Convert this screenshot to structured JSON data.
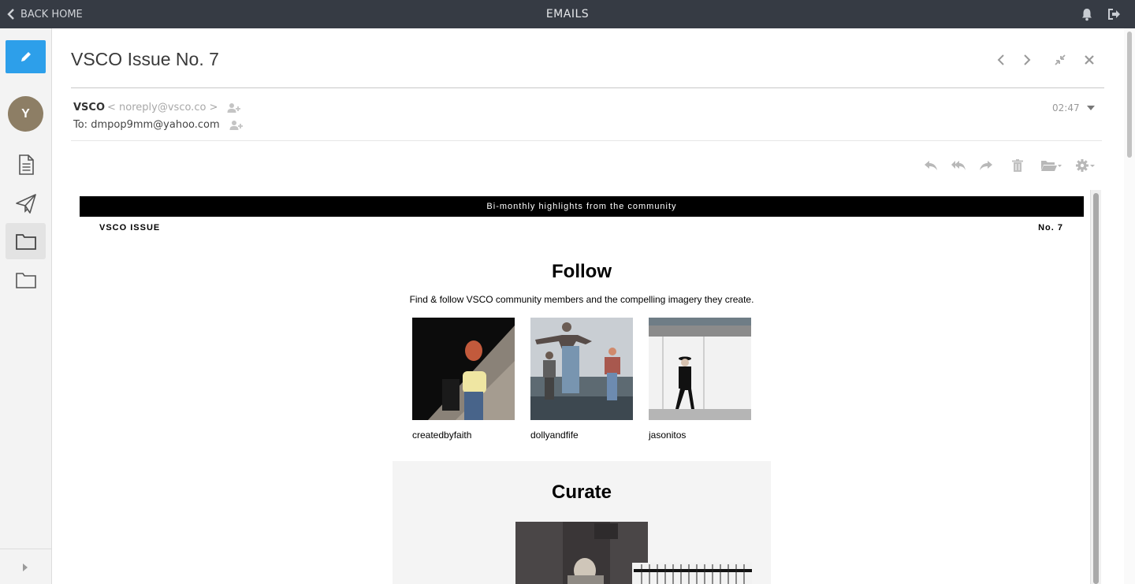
{
  "topbar": {
    "back_label": "BACK HOME",
    "title": "EMAILS"
  },
  "sidebar": {
    "avatar_initial": "Y"
  },
  "email": {
    "subject": "VSCO Issue No. 7",
    "sender_name": "VSCO",
    "sender_address": "< noreply@vsco.co >",
    "to_line": "To: dmpop9mm@yahoo.com",
    "time": "02:47"
  },
  "content": {
    "banner": "Bi-monthly highlights from the community",
    "issue_left": "VSCO ISSUE",
    "issue_right": "No. 7",
    "follow_heading": "Follow",
    "follow_sub": "Find & follow VSCO community members and the compelling imagery they create.",
    "members": [
      {
        "name": "createdbyfaith"
      },
      {
        "name": "dollyandfife"
      },
      {
        "name": "jasonitos"
      }
    ],
    "curate_heading": "Curate"
  },
  "colors": {
    "topbar": "#363b44",
    "compose": "#2d9fea",
    "avatar": "#8d7e65"
  }
}
